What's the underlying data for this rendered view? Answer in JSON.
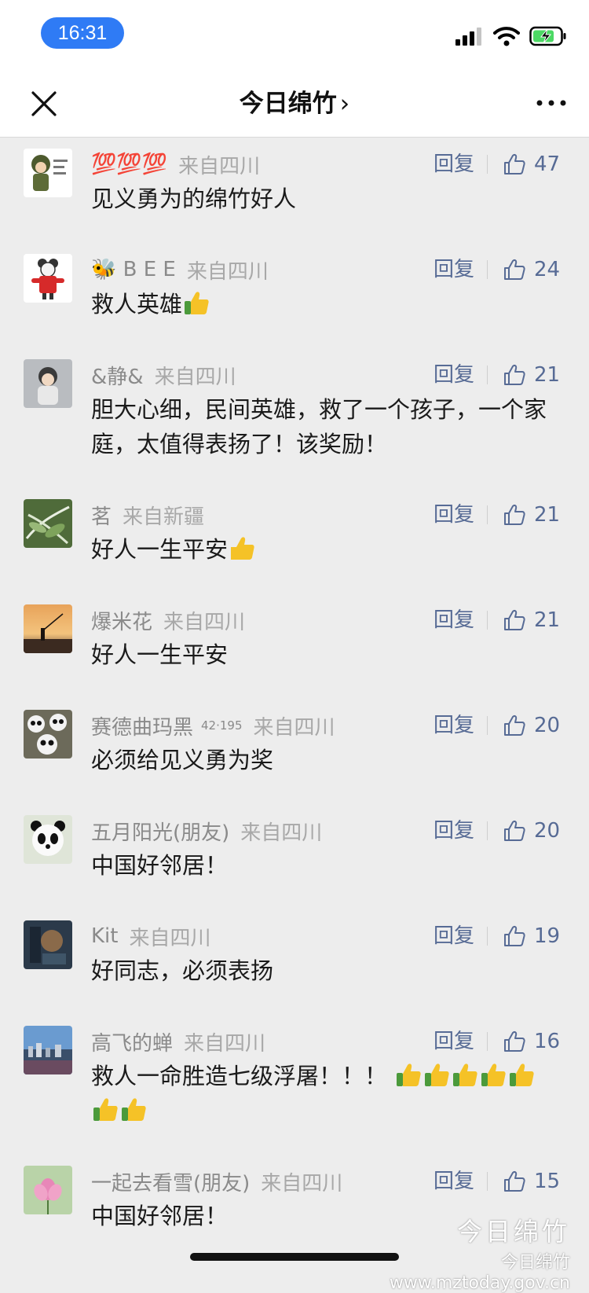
{
  "status_bar": {
    "time": "16:31"
  },
  "nav": {
    "title": "今日绵竹",
    "chevron": "›"
  },
  "comments": [
    {
      "name": "💯💯💯",
      "region": "来自四川",
      "content": "见义勇为的绵竹好人",
      "likes": "47",
      "reply": "回复",
      "avatar": "avatar-soldier-cartoon"
    },
    {
      "name": "🐝 B E E",
      "region": "来自四川",
      "content": "救人英雄",
      "likes": "24",
      "reply": "回复",
      "avatar": "avatar-red-cartoon"
    },
    {
      "name": "&静&",
      "region": "来自四川",
      "content": "胆大心细，民间英雄，救了一个孩子，一个家庭，太值得表扬了！该奖励！",
      "likes": "21",
      "reply": "回复",
      "avatar": "avatar-child"
    },
    {
      "name": "茗",
      "region": "来自新疆",
      "content": "好人一生平安",
      "likes": "21",
      "reply": "回复",
      "avatar": "avatar-leaves"
    },
    {
      "name": "爆米花",
      "region": "来自四川",
      "content": "好人一生平安",
      "likes": "21",
      "reply": "回复",
      "avatar": "avatar-sunset-fishing"
    },
    {
      "name": "赛德曲玛黑",
      "name_suffix": "42·195",
      "region": "来自四川",
      "content": "必须给见义勇为奖",
      "likes": "20",
      "reply": "回复",
      "avatar": "avatar-pandas"
    },
    {
      "name": "五月阳光(朋友)",
      "region": "来自四川",
      "content": "中国好邻居！",
      "likes": "20",
      "reply": "回复",
      "avatar": "avatar-panda"
    },
    {
      "name": "Kit",
      "region": "来自四川",
      "content": "好同志，必须表扬",
      "likes": "19",
      "reply": "回复",
      "avatar": "avatar-dark-art"
    },
    {
      "name": "高飞的蝉",
      "region": "来自四川",
      "content": "救人一命胜造七级浮屠！！！",
      "likes": "16",
      "reply": "回复",
      "avatar": "avatar-city"
    },
    {
      "name": "一起去看雪(朋友)",
      "region": "来自四川",
      "content": "中国好邻居！",
      "likes": "15",
      "reply": "回复",
      "avatar": "avatar-lotus"
    }
  ],
  "watermark": {
    "brand": "今日绵竹",
    "account": "今日绵竹",
    "url": "www.mztoday.gov.cn"
  },
  "colors": {
    "link": "#576b95",
    "background": "#ededed",
    "time_pill": "#2f7bf5"
  }
}
